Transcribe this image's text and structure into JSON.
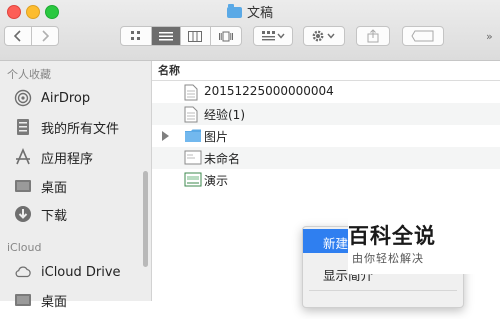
{
  "window": {
    "title": "文稿",
    "colors": {
      "close": "#fd5e56",
      "minimize": "#fdbc2e",
      "zoom": "#2ac840"
    }
  },
  "toolbar": {
    "back_icon": "chevron-left-icon",
    "forward_icon": "chevron-right-icon",
    "view_icons": [
      "icon-view-icon",
      "list-view-icon",
      "column-view-icon",
      "cover-flow-icon"
    ],
    "arrange_icon": "arrange-icon",
    "action_icon": "gear-icon",
    "share_icon": "share-icon",
    "tag_icon": "tag-icon"
  },
  "sidebar": {
    "favorites_header": "个人收藏",
    "favorites": [
      {
        "label": "AirDrop",
        "icon": "airdrop-icon"
      },
      {
        "label": "我的所有文件",
        "icon": "all-files-icon"
      },
      {
        "label": "应用程序",
        "icon": "applications-icon"
      },
      {
        "label": "桌面",
        "icon": "desktop-icon"
      },
      {
        "label": "下载",
        "icon": "download-icon"
      }
    ],
    "icloud_header": "iCloud",
    "icloud": [
      {
        "label": "iCloud Drive",
        "icon": "cloud-icon"
      },
      {
        "label": "桌面",
        "icon": "desktop-icon"
      }
    ]
  },
  "main": {
    "column_header": "名称",
    "rows": [
      {
        "name": "20151225000000004",
        "icon": "document-icon",
        "folder": false
      },
      {
        "name": "经验(1)",
        "icon": "document-icon",
        "folder": false
      },
      {
        "name": "图片",
        "icon": "folder-icon",
        "folder": true
      },
      {
        "name": "未命名",
        "icon": "pages-document-icon",
        "folder": false
      },
      {
        "name": "演示",
        "icon": "keynote-document-icon",
        "folder": false
      }
    ]
  },
  "context_menu": {
    "items": [
      {
        "label": "新建",
        "highlighted": true
      },
      {
        "label": "显示简介",
        "highlighted": false
      },
      {
        "label": "",
        "highlighted": false
      }
    ],
    "highlight_color": "#2f7ff0"
  },
  "watermark": {
    "logo": "百科全说",
    "subtitle": "由你轻松解决"
  }
}
